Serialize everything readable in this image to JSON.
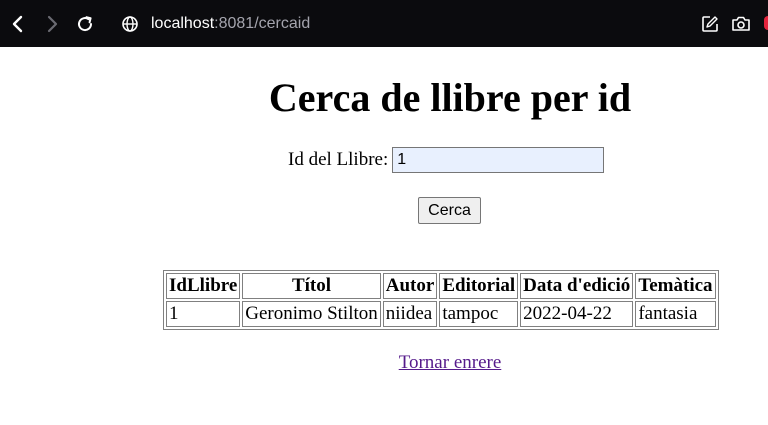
{
  "browser": {
    "url_host": "localhost",
    "url_rest": ":8081/cercaid",
    "icons": [
      "back-arrow-icon",
      "forward-arrow-icon",
      "reload-icon",
      "globe-icon",
      "edit-icon",
      "camera-icon"
    ]
  },
  "page": {
    "title": "Cerca de llibre per id",
    "form": {
      "label": "Id del Llibre:",
      "input_value": "1",
      "submit_label": "Cerca"
    },
    "table": {
      "headers": [
        "IdLlibre",
        "Títol",
        "Autor",
        "Editorial",
        "Data d'edició",
        "Temàtica"
      ],
      "rows": [
        [
          "1",
          "Geronimo Stilton",
          "niidea",
          "tampoc",
          "2022-04-22",
          "fantasia"
        ]
      ]
    },
    "back_link": "Tornar enrere"
  },
  "colors": {
    "browser_bar": "#0b0b0e",
    "input_autofill": "#e8f0fe",
    "visited_link": "#551a8b"
  }
}
